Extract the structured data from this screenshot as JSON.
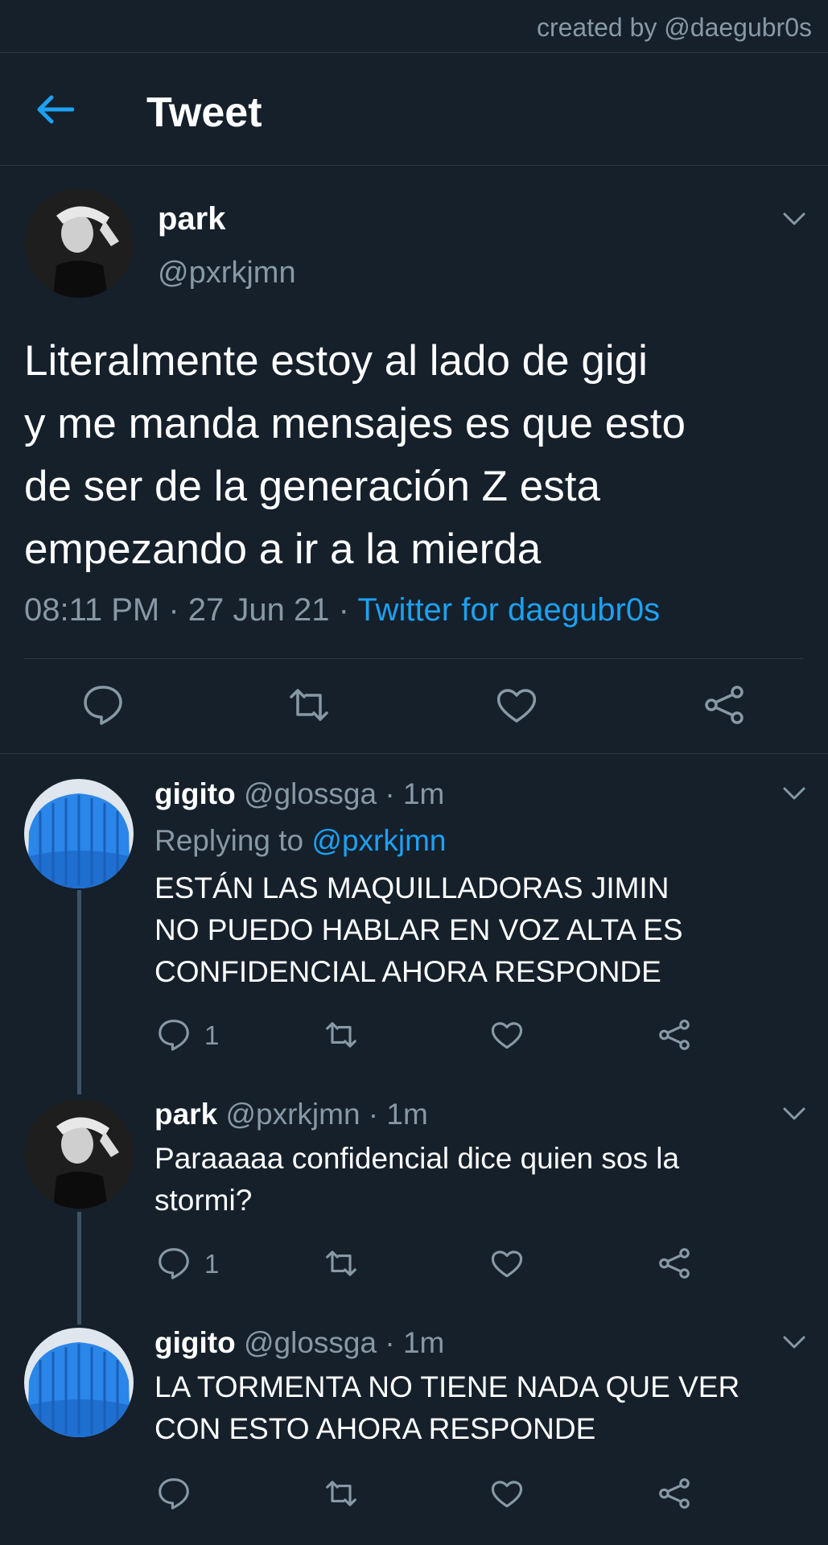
{
  "credit": "created by @daegubr0s",
  "header": {
    "title": "Tweet"
  },
  "main_tweet": {
    "name": "park",
    "handle": "@pxrkjmn",
    "text_lines": [
      "Literalmente estoy al lado de gigi",
      "y me manda mensajes es que esto",
      "de ser de la generación Z esta",
      "empezando a ir a la mierda"
    ],
    "time": "08:11 PM · 27 Jun 21 · ",
    "source": "Twitter for daegubr0s"
  },
  "replies": [
    {
      "name": "gigito",
      "handle_time": "@glossga · 1m",
      "replying_prefix": "Replying to ",
      "replying_to": "@pxrkjmn",
      "text_lines": [
        "ESTÁN LAS MAQUILLADORAS JIMIN",
        "NO PUEDO HABLAR EN VOZ ALTA ES",
        "CONFIDENCIAL AHORA RESPONDE"
      ],
      "reply_count": "1"
    },
    {
      "name": "park",
      "handle_time": "@pxrkjmn · 1m",
      "text_lines": [
        "Paraaaaa confidencial dice quien sos la",
        "stormi?"
      ],
      "reply_count": "1"
    },
    {
      "name": "gigito",
      "handle_time": "@glossga · 1m",
      "text_lines": [
        "LA TORMENTA NO TIENE NADA QUE VER",
        "CON ESTO AHORA RESPONDE"
      ],
      "reply_count": ""
    }
  ],
  "icons": {
    "back": "arrow-left-icon",
    "reply": "reply-icon",
    "retweet": "retweet-icon",
    "like": "heart-icon",
    "share": "share-icon",
    "more": "chevron-down-icon"
  },
  "colors": {
    "background": "#15202b",
    "accent": "#1da1f2",
    "secondary_text": "#8899a6",
    "divider": "#2a3845",
    "thread_line": "#3d5466"
  }
}
